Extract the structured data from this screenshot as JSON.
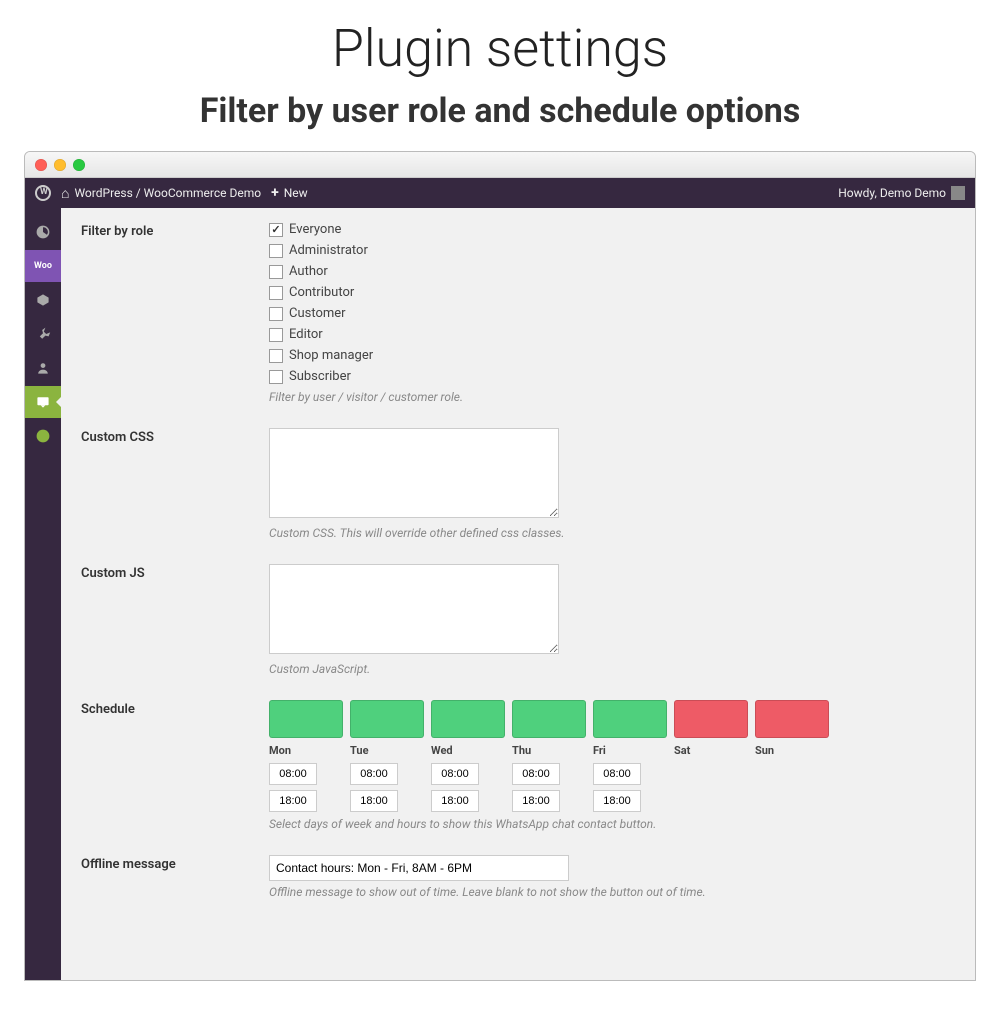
{
  "page": {
    "title": "Plugin settings",
    "subtitle": "Filter by user role and schedule options"
  },
  "adminbar": {
    "site_name": "WordPress / WooCommerce Demo",
    "new_label": "New",
    "howdy": "Howdy, Demo Demo"
  },
  "filter_by_role": {
    "label": "Filter by role",
    "help": "Filter by user / visitor / customer role.",
    "options": [
      {
        "label": "Everyone",
        "checked": true
      },
      {
        "label": "Administrator",
        "checked": false
      },
      {
        "label": "Author",
        "checked": false
      },
      {
        "label": "Contributor",
        "checked": false
      },
      {
        "label": "Customer",
        "checked": false
      },
      {
        "label": "Editor",
        "checked": false
      },
      {
        "label": "Shop manager",
        "checked": false
      },
      {
        "label": "Subscriber",
        "checked": false
      }
    ]
  },
  "custom_css": {
    "label": "Custom CSS",
    "value": "",
    "help": "Custom CSS. This will override other defined css classes."
  },
  "custom_js": {
    "label": "Custom JS",
    "value": "",
    "help": "Custom JavaScript."
  },
  "schedule": {
    "label": "Schedule",
    "help": "Select days of week and hours to show this WhatsApp chat contact button.",
    "days": [
      {
        "name": "Mon",
        "active": true,
        "start": "08:00",
        "end": "18:00"
      },
      {
        "name": "Tue",
        "active": true,
        "start": "08:00",
        "end": "18:00"
      },
      {
        "name": "Wed",
        "active": true,
        "start": "08:00",
        "end": "18:00"
      },
      {
        "name": "Thu",
        "active": true,
        "start": "08:00",
        "end": "18:00"
      },
      {
        "name": "Fri",
        "active": true,
        "start": "08:00",
        "end": "18:00"
      },
      {
        "name": "Sat",
        "active": false,
        "start": "",
        "end": ""
      },
      {
        "name": "Sun",
        "active": false,
        "start": "",
        "end": ""
      }
    ]
  },
  "offline": {
    "label": "Offline message",
    "value": "Contact hours: Mon - Fri, 8AM - 6PM",
    "help": "Offline message to show out of time. Leave blank to not show the button out of time."
  }
}
